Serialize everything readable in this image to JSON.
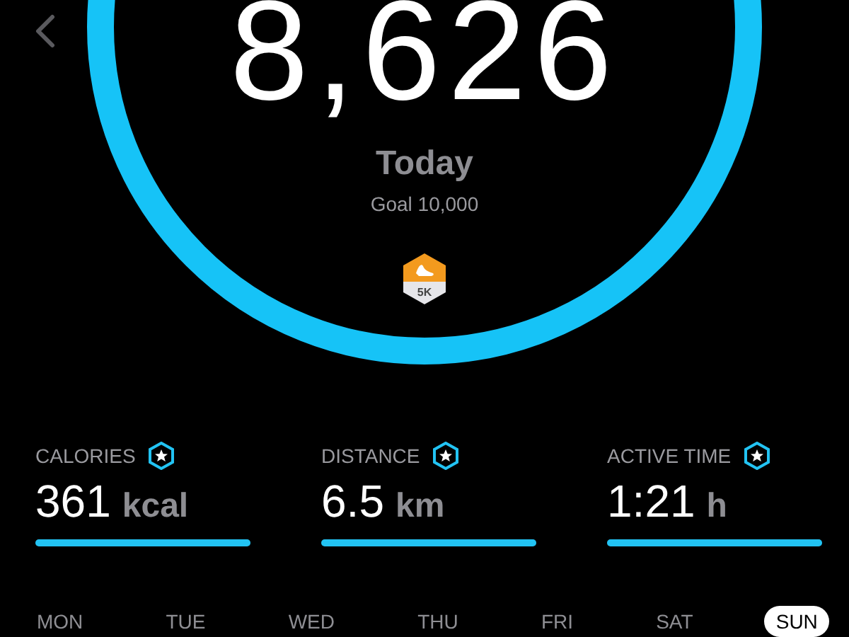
{
  "steps": {
    "value": "8,626",
    "label": "Today",
    "goal": "Goal 10,000",
    "badge": "5K"
  },
  "stats": [
    {
      "label": "CALORIES",
      "value": "361",
      "unit": "kcal",
      "level": 1
    },
    {
      "label": "DISTANCE",
      "value": "6.5",
      "unit": "km",
      "level": 1
    },
    {
      "label": "ACTIVE TIME",
      "value": "1:21",
      "unit": "h",
      "level": 1
    }
  ],
  "days": [
    {
      "label": "MON",
      "selected": false
    },
    {
      "label": "TUE",
      "selected": false
    },
    {
      "label": "WED",
      "selected": false
    },
    {
      "label": "THU",
      "selected": false
    },
    {
      "label": "FRI",
      "selected": false
    },
    {
      "label": "SAT",
      "selected": false
    },
    {
      "label": "SUN",
      "selected": true
    }
  ]
}
